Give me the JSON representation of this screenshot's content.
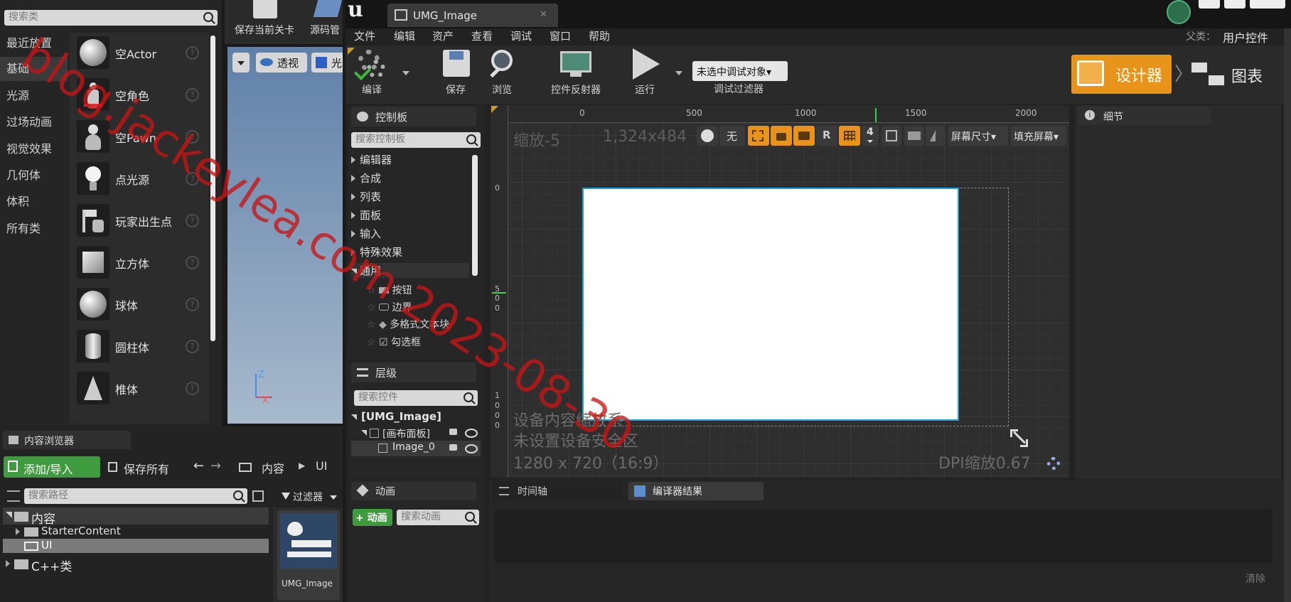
{
  "place_panel": {
    "search_placeholder": "搜索类",
    "categories": [
      "最近放置",
      "基础",
      "光源",
      "过场动画",
      "视觉效果",
      "几何体",
      "体积",
      "所有类"
    ],
    "selected_category": "基础",
    "items": [
      "空Actor",
      "空角色",
      "空Pawn",
      "点光源",
      "玩家出生点",
      "立方体",
      "球体",
      "圆柱体",
      "椎体"
    ]
  },
  "level_toolbar": {
    "save_level": "保存当前关卡",
    "source_control": "源码管",
    "perspective": "透视",
    "lit": "光"
  },
  "content_browser": {
    "tab": "内容浏览器",
    "add_import": "添加/导入",
    "save_all": "保存所有",
    "breadcrumb": [
      "内容",
      "UI"
    ],
    "search_placeholder": "搜索路径",
    "filters": "过滤器",
    "tree": [
      "内容",
      "StarterContent",
      "UI",
      "C++类"
    ],
    "asset_name": "UMG_Image"
  },
  "umg_editor": {
    "tab_title": "UMG_Image",
    "menus": [
      "文件",
      "编辑",
      "资产",
      "查看",
      "调试",
      "窗口",
      "帮助"
    ],
    "parent_label": "父类：",
    "parent_value": "用户控件",
    "toolbar": {
      "compile": "编译",
      "save": "保存",
      "browse": "浏览",
      "widget_reflector": "控件反射器",
      "run": "运行",
      "debug_dropdown": "未选中调试对象▾",
      "debug_filter": "调试过滤器"
    },
    "mode_designer": "设计器",
    "mode_graph": "图表"
  },
  "palette": {
    "title": "控制板",
    "search_placeholder": "搜索控制板",
    "categories": [
      "编辑器",
      "合成",
      "列表",
      "面板",
      "输入",
      "特殊效果",
      "通用"
    ],
    "common_items": [
      "按钮",
      "边界",
      "多格式文本块",
      "勾选框"
    ]
  },
  "hierarchy": {
    "title": "层级",
    "search_placeholder": "搜索控件",
    "root": "[UMG_Image]",
    "canvas": "[画布面板]",
    "image": "Image_0"
  },
  "designer": {
    "zoom": "缩放-5",
    "resolution": "1,324x484",
    "ruler_top": [
      "0",
      "500",
      "1000",
      "1500",
      "2000"
    ],
    "ruler_left": [
      "0",
      "5",
      "0",
      "0",
      "1",
      "0",
      "0",
      "0"
    ],
    "none_label": "无",
    "r_label": "R",
    "grid_value": "4",
    "screen_size": "屏幕尺寸▾",
    "fill_screen": "填充屏幕▾",
    "device_line1": "设备内容缩放系",
    "device_line2": "未设置设备安全区",
    "device_line3": "1280 x 720（16:9）",
    "dpi": "DPI缩放0.67"
  },
  "details": {
    "title": "细节"
  },
  "animation": {
    "title": "动画",
    "add_button": "+ 动画",
    "search_placeholder": "搜索动画"
  },
  "bottom_tabs": {
    "timeline": "时间轴",
    "compiler_results": "编译器结果",
    "clear": "清除"
  },
  "watermark": "blog.jackeylea.com 2023-08-30",
  "colors": {
    "accent_orange": "#e8941a",
    "selection_blue": "#1aa3e8",
    "add_green": "#3e9b3e"
  }
}
